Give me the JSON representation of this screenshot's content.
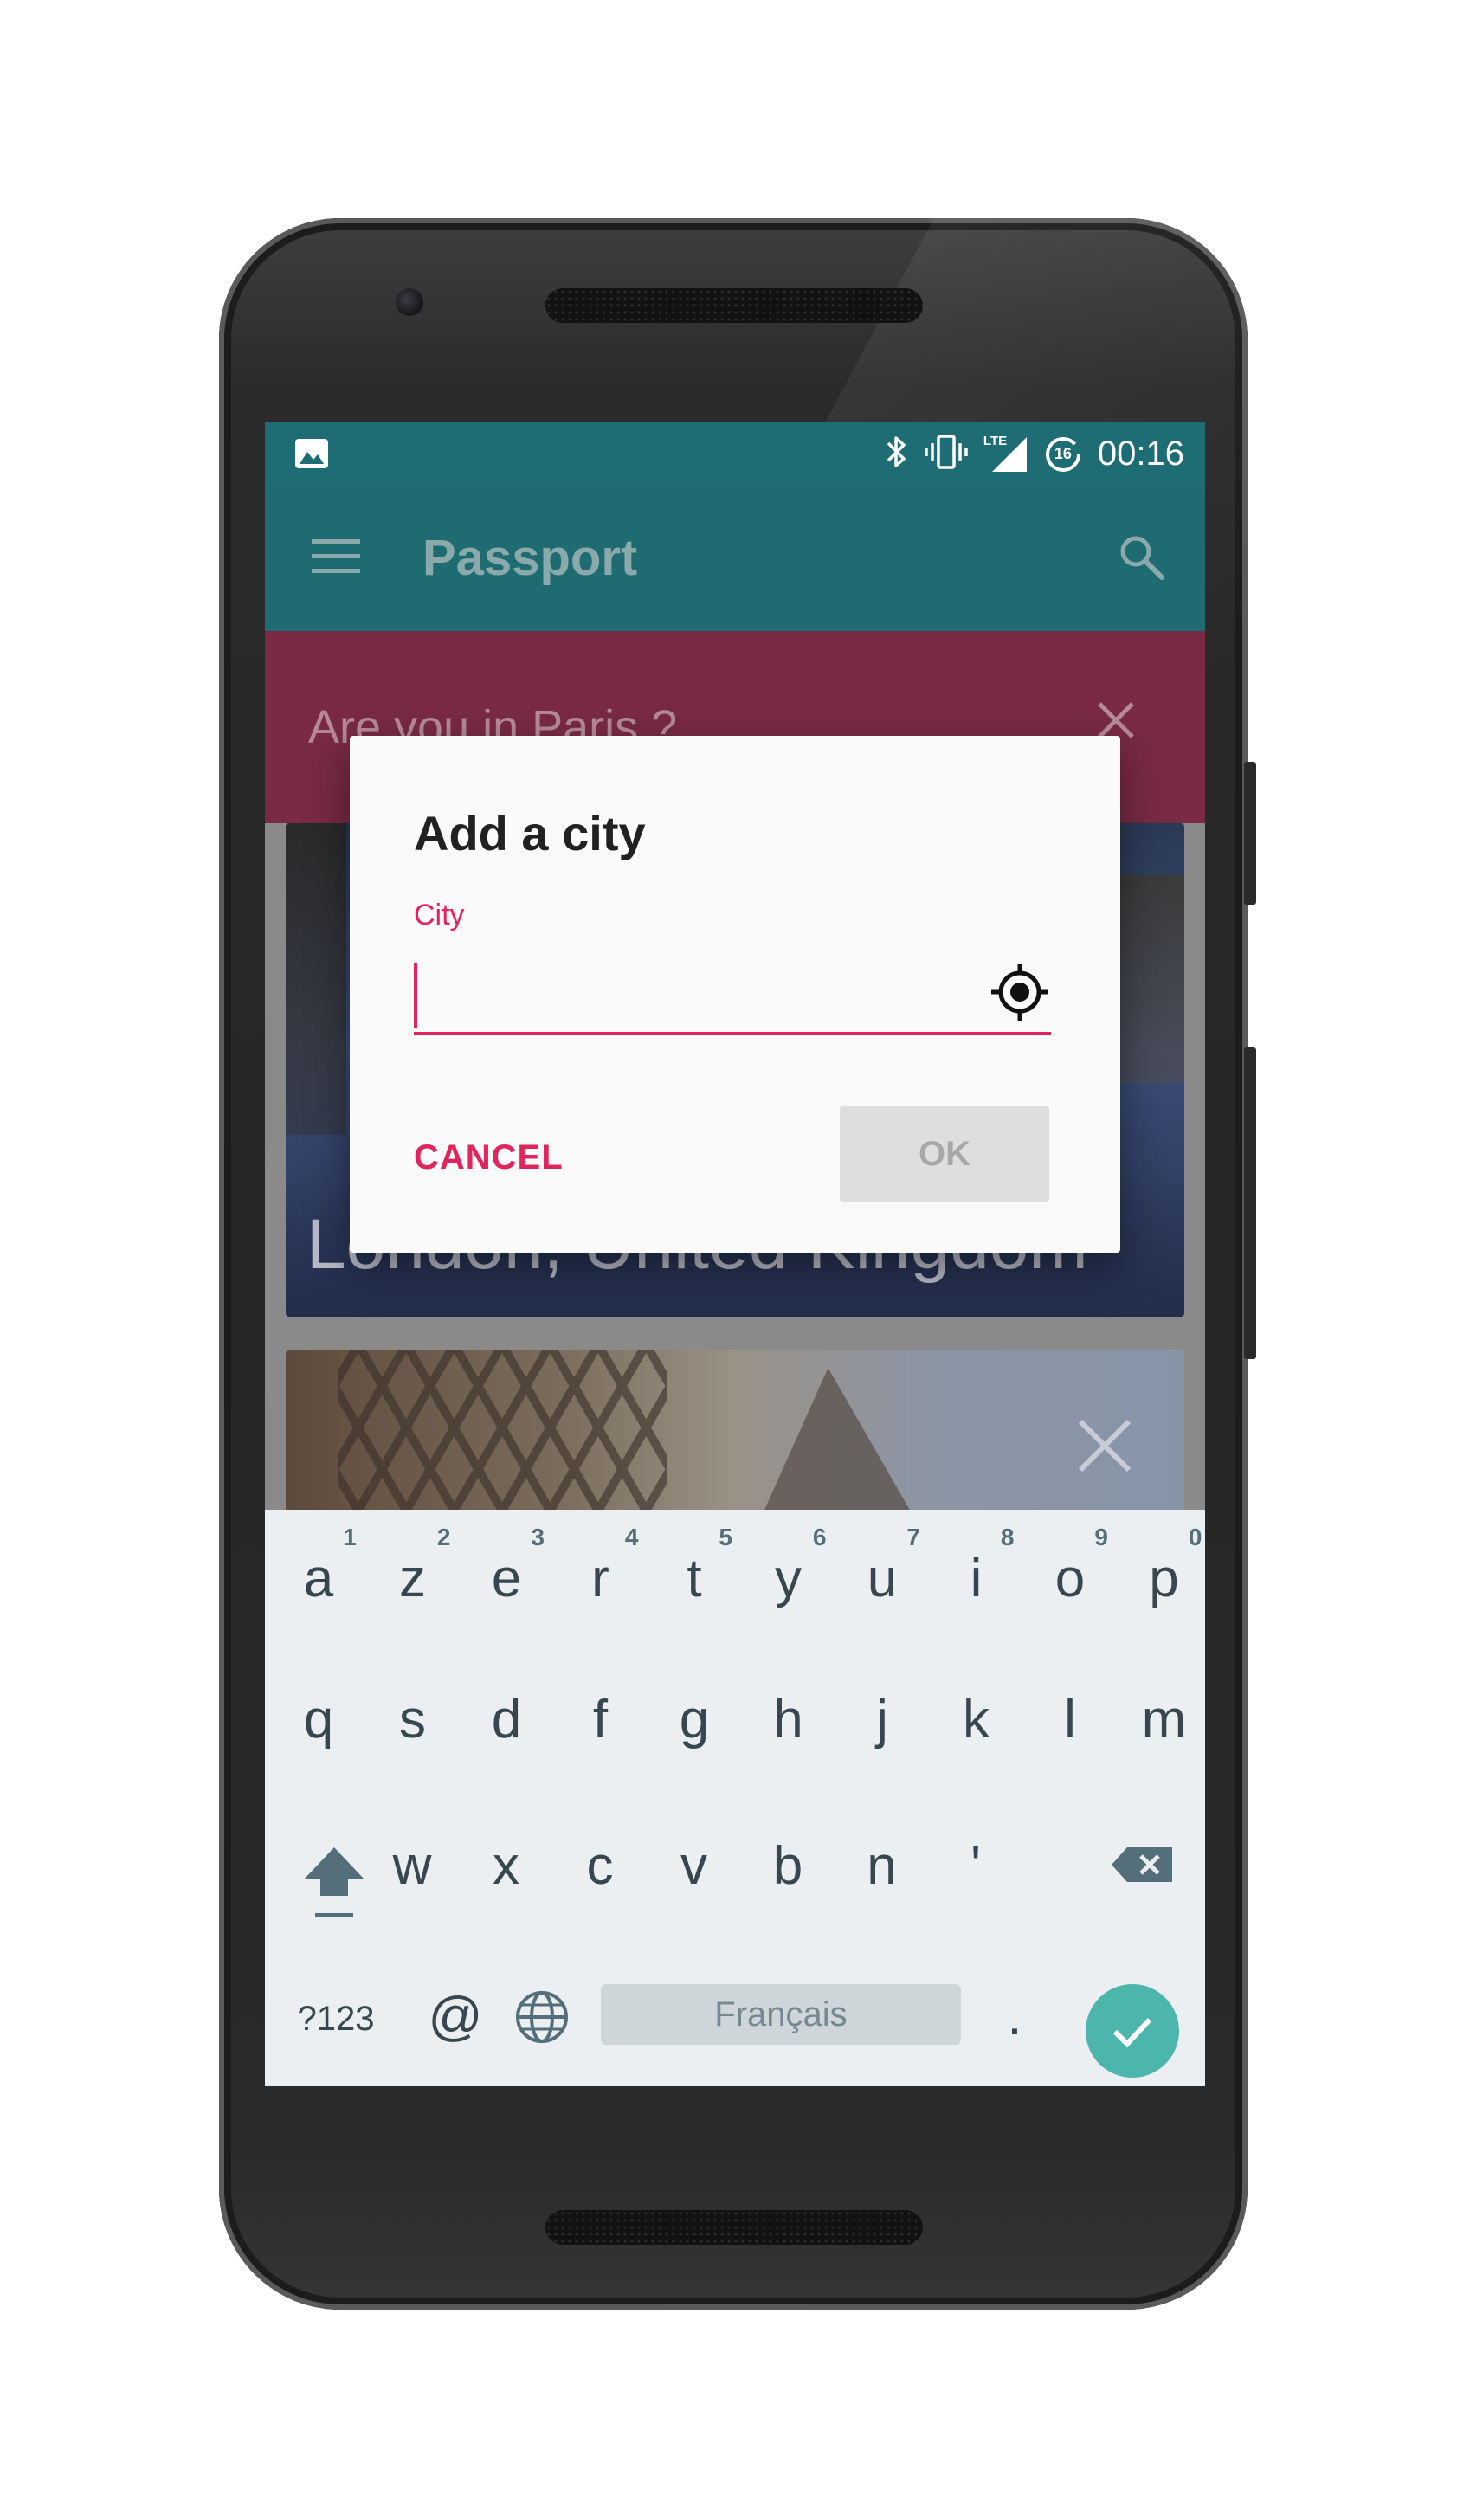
{
  "status_bar": {
    "time": "00:16",
    "network_label": "LTE",
    "data_saver_badge": "16",
    "icons": [
      "image-notification-icon",
      "bluetooth-icon",
      "vibrate-icon",
      "lte-signal-icon",
      "data-saver-icon"
    ]
  },
  "app_bar": {
    "title": "Passport",
    "menu_icon": "hamburger-menu-icon",
    "search_icon": "search-icon"
  },
  "banner": {
    "text": "Are you in Paris ?",
    "close_icon": "close-icon"
  },
  "cards": [
    {
      "title": "London, United Kingdom"
    },
    {
      "title": ""
    }
  ],
  "dialog": {
    "title": "Add a city",
    "field_label": "City",
    "field_value": "",
    "locate_icon": "my-location-icon",
    "cancel_label": "CANCEL",
    "ok_label": "OK"
  },
  "keyboard": {
    "row1": [
      {
        "letter": "a",
        "hint": "1"
      },
      {
        "letter": "z",
        "hint": "2"
      },
      {
        "letter": "e",
        "hint": "3"
      },
      {
        "letter": "r",
        "hint": "4"
      },
      {
        "letter": "t",
        "hint": "5"
      },
      {
        "letter": "y",
        "hint": "6"
      },
      {
        "letter": "u",
        "hint": "7"
      },
      {
        "letter": "i",
        "hint": "8"
      },
      {
        "letter": "o",
        "hint": "9"
      },
      {
        "letter": "p",
        "hint": "0"
      }
    ],
    "row2": [
      "q",
      "s",
      "d",
      "f",
      "g",
      "h",
      "j",
      "k",
      "l",
      "m"
    ],
    "row3": [
      "w",
      "x",
      "c",
      "v",
      "b",
      "n",
      "'"
    ],
    "symbols_label": "?123",
    "at_label": "@",
    "space_label": "Français",
    "period_label": ".",
    "colors": {
      "accent": "#e0245e",
      "enter": "#4db6ac",
      "app_bar": "#1f6b72",
      "banner": "#7a2a45"
    }
  }
}
